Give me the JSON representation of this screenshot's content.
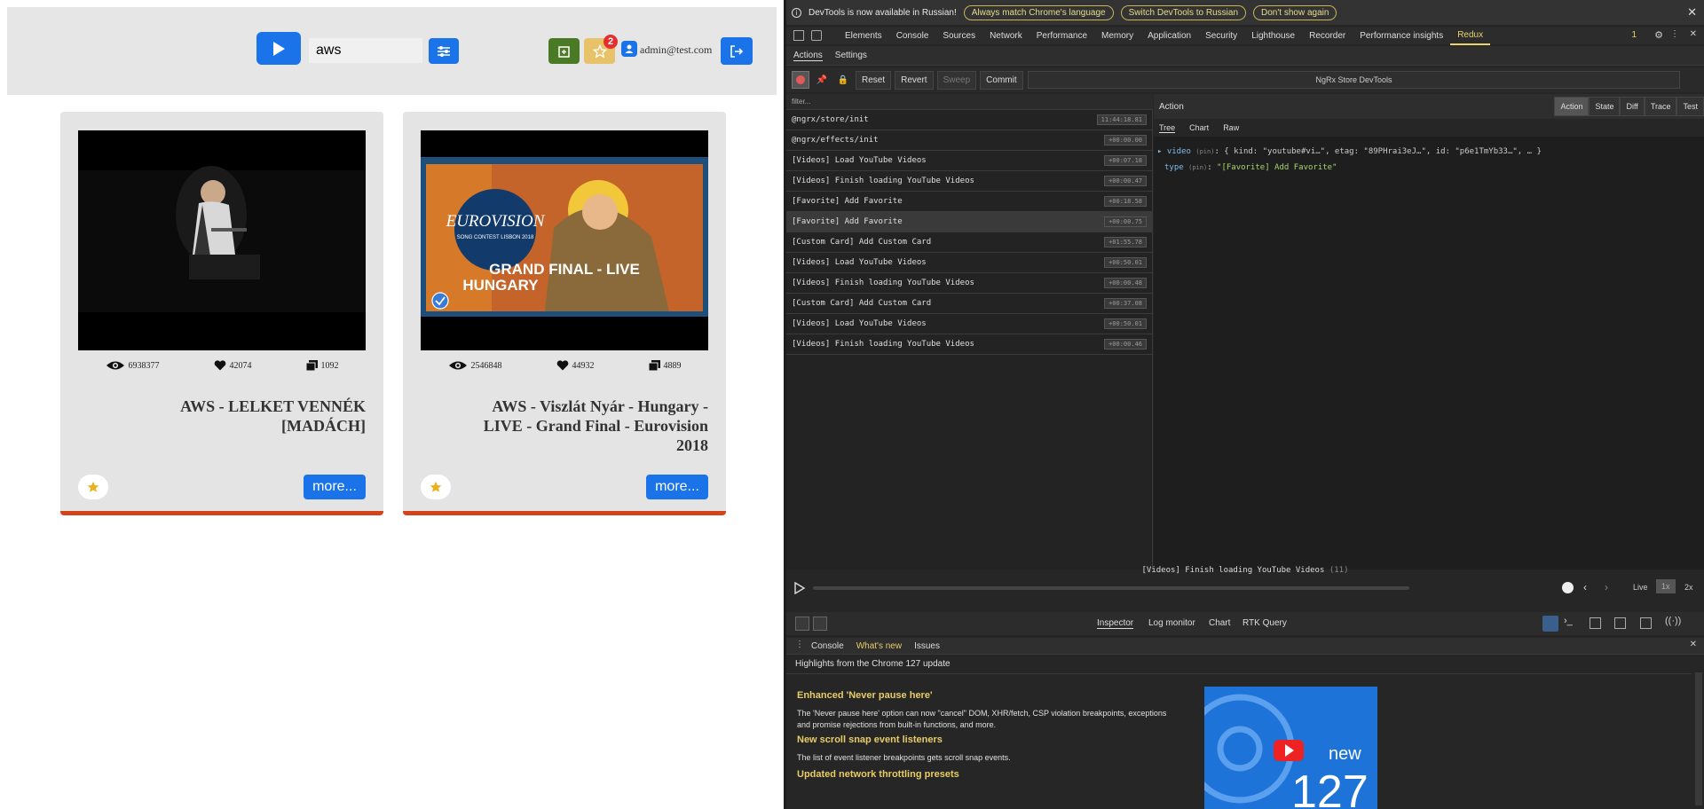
{
  "app": {
    "search_value": "aws",
    "fav_count": "2",
    "user_email": "admin@test.com",
    "cards": [
      {
        "views": "6938377",
        "likes": "42074",
        "comments": "1092",
        "title": "AWS - LELKET VENNÉK [MADÁCH]",
        "more_label": "more..."
      },
      {
        "views": "2546848",
        "likes": "44932",
        "comments": "4889",
        "title": "AWS - Viszlát Nyár - Hungary - LIVE - Grand Final - Eurovision 2018",
        "more_label": "more..."
      }
    ],
    "eurovision_logo": "EUROVISION",
    "eurovision_sub": "SONG CONTEST LISBON 2018",
    "thumb_caption": "GRAND FINAL - LIVE\nHUNGARY"
  },
  "devtools": {
    "info_text": "DevTools is now available in Russian!",
    "info_btn1": "Always match Chrome's language",
    "info_btn2": "Switch DevTools to Russian",
    "info_btn3": "Don't show again",
    "tabs": [
      "Elements",
      "Console",
      "Sources",
      "Network",
      "Performance",
      "Memory",
      "Application",
      "Security",
      "Lighthouse",
      "Recorder",
      "Performance insights",
      "Redux"
    ],
    "issues_count": "1",
    "redux_tabs": [
      "Actions",
      "Settings"
    ],
    "toolbar": {
      "reset": "Reset",
      "revert": "Revert",
      "sweep": "Sweep",
      "commit": "Commit",
      "instance": "NgRx Store DevTools"
    },
    "filter_placeholder": "filter...",
    "actions": [
      {
        "name": "@ngrx/store/init",
        "time": "11:44:18.81"
      },
      {
        "name": "@ngrx/effects/init",
        "time": "+00:00.00"
      },
      {
        "name": "[Videos] Load YouTube Videos",
        "time": "+00:07.18"
      },
      {
        "name": "[Videos] Finish loading YouTube Videos",
        "time": "+00:00.47"
      },
      {
        "name": "[Favorite] Add Favorite",
        "time": "+00:18.58"
      },
      {
        "name": "[Favorite] Add Favorite",
        "time": "+00:00.75"
      },
      {
        "name": "[Custom Card] Add Custom Card",
        "time": "+01:55.78"
      },
      {
        "name": "[Videos] Load YouTube Videos",
        "time": "+00:50.01"
      },
      {
        "name": "[Videos] Finish loading YouTube Videos",
        "time": "+00:00.48"
      },
      {
        "name": "[Custom Card] Add Custom Card",
        "time": "+00:37.08"
      },
      {
        "name": "[Videos] Load YouTube Videos",
        "time": "+00:50.01"
      },
      {
        "name": "[Videos] Finish loading YouTube Videos",
        "time": "+00:00.46"
      }
    ],
    "panel_title": "Action",
    "panel_tabs": [
      "Action",
      "State",
      "Diff",
      "Trace",
      "Test"
    ],
    "sub_tabs": [
      "Tree",
      "Chart",
      "Raw"
    ],
    "tree_line1_key": "video",
    "tree_line1_val": "{ kind: \"youtube#vi…\", etag: \"89PHrai3eJ…\", id: \"p6e1TmYb33…\", … }",
    "tree_line2_key": "type",
    "tree_line2_val": "\"[Favorite] Add Favorite\"",
    "pin_label": "(pin)",
    "slider_label": "[Videos] Finish loading YouTube Videos",
    "slider_count": "(11)",
    "speed_live": "Live",
    "speed_1x": "1x",
    "speed_2x": "2x",
    "bottom_tabs": [
      "Inspector",
      "Log monitor",
      "Chart",
      "RTK Query"
    ],
    "drawer_tabs": [
      "Console",
      "What's new",
      "Issues"
    ],
    "whats_new_header": "Highlights from the Chrome 127 update",
    "wn1_title": "Enhanced 'Never pause here'",
    "wn1_text": "The 'Never pause here' option can now \"cancel\" DOM, XHR/fetch, CSP violation breakpoints, exceptions and promise rejections from built-in functions, and more.",
    "wn2_title": "New scroll snap event listeners",
    "wn2_text": "The list of event listener breakpoints gets scroll snap events.",
    "wn3_title": "Updated network throttling presets",
    "promo_new": "new",
    "promo_num": "127"
  }
}
